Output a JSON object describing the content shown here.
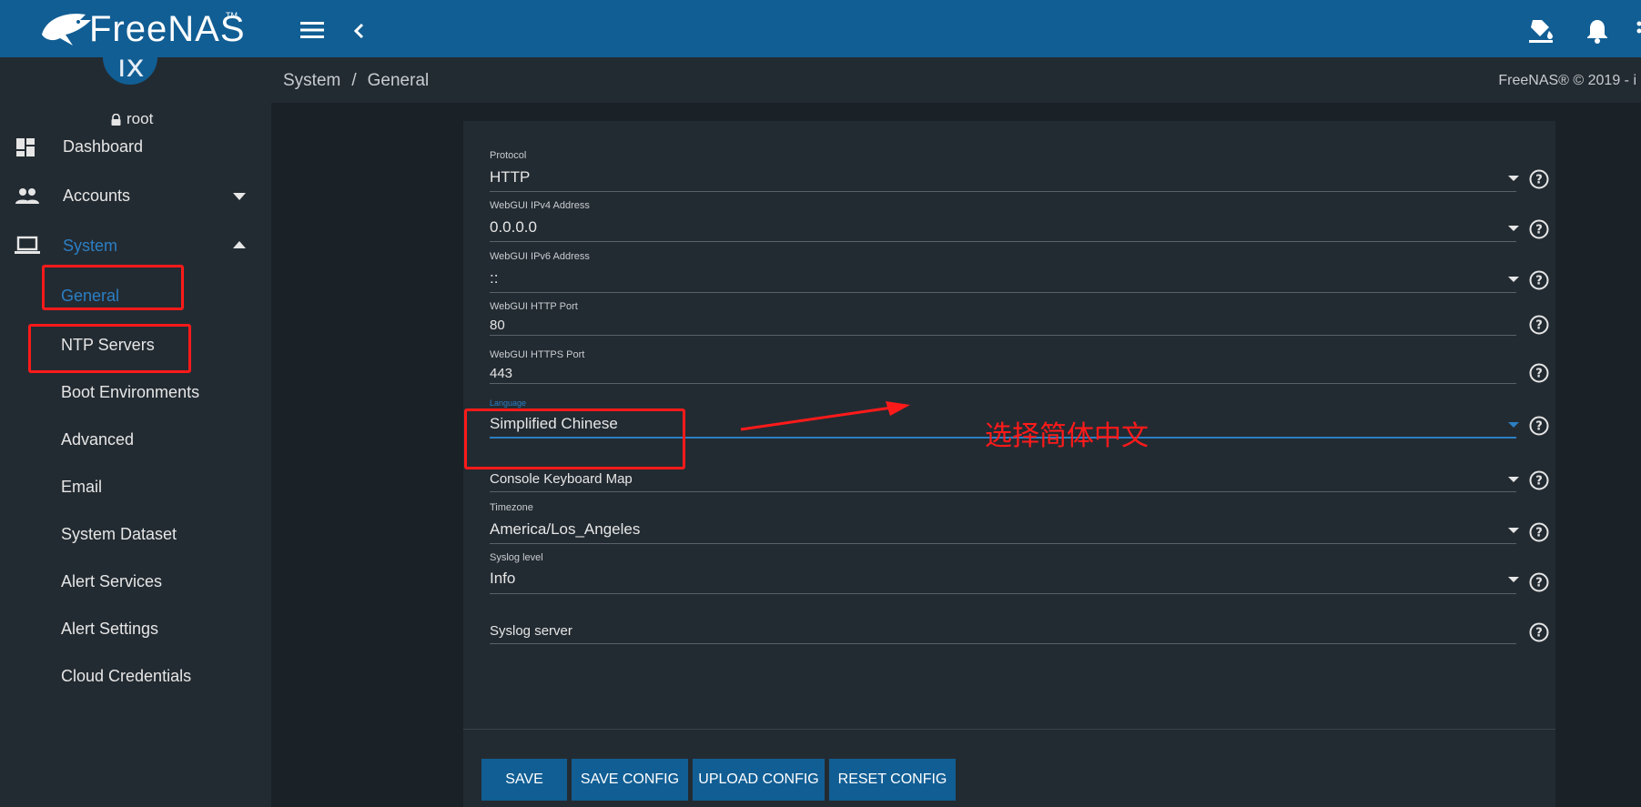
{
  "app": {
    "logo_text": "FreeNAS",
    "logo_tm": "TM"
  },
  "user": {
    "name": "root",
    "avatar_glyph": "ix"
  },
  "sidebar": {
    "items": [
      {
        "label": "Dashboard",
        "icon": "dashboard-icon"
      },
      {
        "label": "Accounts",
        "icon": "people-icon"
      },
      {
        "label": "System",
        "icon": "laptop-icon"
      }
    ],
    "submenu": [
      "General",
      "NTP Servers",
      "Boot Environments",
      "Advanced",
      "Email",
      "System Dataset",
      "Alert Services",
      "Alert Settings",
      "Cloud Credentials"
    ]
  },
  "breadcrumb": {
    "parent": "System",
    "separator": "/",
    "current": "General"
  },
  "copyright": "FreeNAS® © 2019 - i",
  "form": {
    "fields": [
      {
        "label": "Protocol",
        "value": "HTTP"
      },
      {
        "label": "WebGUI IPv4 Address",
        "value": "0.0.0.0"
      },
      {
        "label": "WebGUI IPv6 Address",
        "value": "::"
      },
      {
        "label": "WebGUI HTTP Port",
        "value": "80"
      },
      {
        "label": "WebGUI HTTPS Port",
        "value": "443"
      },
      {
        "label": "Language",
        "value": "Simplified Chinese"
      },
      {
        "label": "",
        "value": "Console Keyboard Map"
      },
      {
        "label": "Timezone",
        "value": "America/Los_Angeles"
      },
      {
        "label": "Syslog level",
        "value": "Info"
      },
      {
        "label": "",
        "value": "Syslog server"
      }
    ],
    "buttons": {
      "save": "SAVE",
      "save_config": "SAVE CONFIG",
      "upload_config": "UPLOAD CONFIG",
      "reset_config": "RESET CONFIG"
    }
  },
  "annotation": {
    "text": "选择简体中文",
    "color": "#ff1a1a"
  },
  "colors": {
    "topbar": "#115e94",
    "sidebar": "#232b32",
    "background": "#1a2127",
    "accent": "#2b7fc4"
  }
}
